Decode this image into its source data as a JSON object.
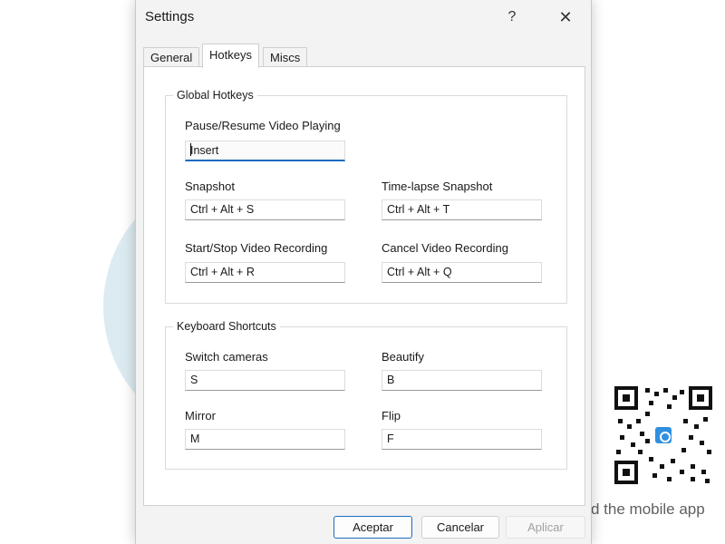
{
  "background_app": {
    "mobile_app_text": "d the mobile app"
  },
  "dialog": {
    "title": "Settings",
    "help_label": "?",
    "close_label": "✕"
  },
  "tabs": [
    {
      "label": "General",
      "active": false
    },
    {
      "label": "Hotkeys",
      "active": true
    },
    {
      "label": "Miscs",
      "active": false
    }
  ],
  "global_hotkeys": {
    "legend": "Global Hotkeys",
    "pause_resume": {
      "label": "Pause/Resume Video Playing",
      "value": "Insert"
    },
    "snapshot": {
      "label": "Snapshot",
      "value": "Ctrl + Alt + S"
    },
    "timelapse": {
      "label": "Time-lapse Snapshot",
      "value": "Ctrl + Alt + T"
    },
    "start_stop_recording": {
      "label": "Start/Stop Video Recording",
      "value": "Ctrl + Alt + R"
    },
    "cancel_recording": {
      "label": "Cancel Video Recording",
      "value": "Ctrl + Alt + Q"
    }
  },
  "keyboard_shortcuts": {
    "legend": "Keyboard Shortcuts",
    "switch_cameras": {
      "label": "Switch cameras",
      "value": "S"
    },
    "beautify": {
      "label": "Beautify",
      "value": "B"
    },
    "mirror": {
      "label": "Mirror",
      "value": "M"
    },
    "flip": {
      "label": "Flip",
      "value": "F"
    }
  },
  "footer": {
    "accept_label": "Aceptar",
    "cancel_label": "Cancelar",
    "apply_label": "Aplicar"
  },
  "colors": {
    "accent": "#1e6cc2",
    "dialog_bg": "#f3f3f3",
    "panel_bg": "#ffffff",
    "qr_logo": "#2f8fe0"
  }
}
